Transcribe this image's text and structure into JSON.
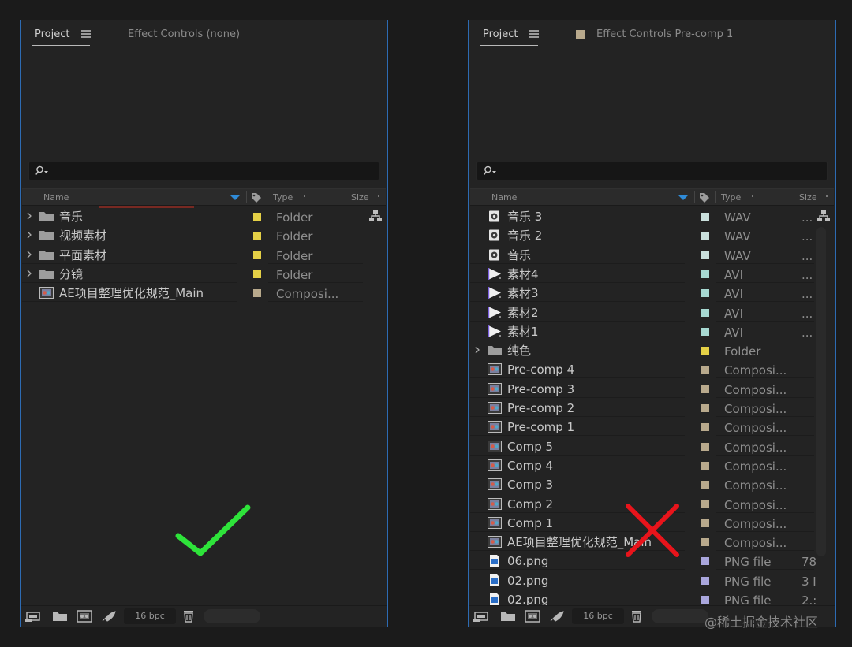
{
  "left_panel": {
    "tab_project": "Project",
    "tab_effect": "Effect Controls (none)",
    "columns": {
      "name": "Name",
      "type": "Type",
      "size": "Size"
    },
    "items": [
      {
        "name": "音乐",
        "kind": "folder",
        "expandable": true,
        "label_color": "#e4d046",
        "type": "Folder",
        "size": ""
      },
      {
        "name": "视频素材",
        "kind": "folder",
        "expandable": true,
        "label_color": "#e4d046",
        "type": "Folder",
        "size": ""
      },
      {
        "name": "平面素材",
        "kind": "folder",
        "expandable": true,
        "label_color": "#e4d046",
        "type": "Folder",
        "size": ""
      },
      {
        "name": "分镜",
        "kind": "folder",
        "expandable": true,
        "label_color": "#e4d046",
        "type": "Folder",
        "size": ""
      },
      {
        "name": "AE项目整理优化规范_Main",
        "kind": "comp",
        "expandable": false,
        "label_color": "#b8a98c",
        "type": "Composi...",
        "size": ""
      }
    ],
    "bpc": "16 bpc"
  },
  "right_panel": {
    "tab_project": "Project",
    "tab_effect": "Effect Controls Pre-comp 1",
    "tab_swatch_color": "#b8a98c",
    "columns": {
      "name": "Name",
      "type": "Type",
      "size": "Size"
    },
    "items": [
      {
        "name": "音乐 3",
        "kind": "audio",
        "expandable": false,
        "label_color": "#c9dfdc",
        "type": "WAV",
        "size": "..."
      },
      {
        "name": "音乐 2",
        "kind": "audio",
        "expandable": false,
        "label_color": "#c9dfdc",
        "type": "WAV",
        "size": "..."
      },
      {
        "name": "音乐",
        "kind": "audio",
        "expandable": false,
        "label_color": "#c9dfdc",
        "type": "WAV",
        "size": "..."
      },
      {
        "name": "素材4",
        "kind": "video",
        "expandable": false,
        "label_color": "#a7d9d2",
        "type": "AVI",
        "size": "..."
      },
      {
        "name": "素材3",
        "kind": "video",
        "expandable": false,
        "label_color": "#a7d9d2",
        "type": "AVI",
        "size": "..."
      },
      {
        "name": "素材2",
        "kind": "video",
        "expandable": false,
        "label_color": "#a7d9d2",
        "type": "AVI",
        "size": "..."
      },
      {
        "name": "素材1",
        "kind": "video",
        "expandable": false,
        "label_color": "#a7d9d2",
        "type": "AVI",
        "size": "..."
      },
      {
        "name": "纯色",
        "kind": "folder",
        "expandable": true,
        "label_color": "#e4d046",
        "type": "Folder",
        "size": ""
      },
      {
        "name": "Pre-comp 4",
        "kind": "comp",
        "expandable": false,
        "label_color": "#b8a98c",
        "type": "Composi...",
        "size": ""
      },
      {
        "name": "Pre-comp 3",
        "kind": "comp",
        "expandable": false,
        "label_color": "#b8a98c",
        "type": "Composi...",
        "size": ""
      },
      {
        "name": "Pre-comp 2",
        "kind": "comp",
        "expandable": false,
        "label_color": "#b8a98c",
        "type": "Composi...",
        "size": ""
      },
      {
        "name": "Pre-comp 1",
        "kind": "comp",
        "expandable": false,
        "label_color": "#b8a98c",
        "type": "Composi...",
        "size": ""
      },
      {
        "name": "Comp 5",
        "kind": "comp",
        "expandable": false,
        "label_color": "#b8a98c",
        "type": "Composi...",
        "size": ""
      },
      {
        "name": "Comp 4",
        "kind": "comp",
        "expandable": false,
        "label_color": "#b8a98c",
        "type": "Composi...",
        "size": ""
      },
      {
        "name": "Comp 3",
        "kind": "comp",
        "expandable": false,
        "label_color": "#b8a98c",
        "type": "Composi...",
        "size": ""
      },
      {
        "name": "Comp 2",
        "kind": "comp",
        "expandable": false,
        "label_color": "#b8a98c",
        "type": "Composi...",
        "size": ""
      },
      {
        "name": "Comp 1",
        "kind": "comp",
        "expandable": false,
        "label_color": "#b8a98c",
        "type": "Composi...",
        "size": ""
      },
      {
        "name": "AE项目整理优化规范_Main",
        "kind": "comp",
        "expandable": false,
        "label_color": "#b8a98c",
        "type": "Composi...",
        "size": ""
      },
      {
        "name": "06.png",
        "kind": "image",
        "expandable": false,
        "label_color": "#a9a6dc",
        "type": "PNG file",
        "size": "78"
      },
      {
        "name": "02.png",
        "kind": "image",
        "expandable": false,
        "label_color": "#a9a6dc",
        "type": "PNG file",
        "size": "3 I"
      },
      {
        "name": "02.png",
        "kind": "image",
        "expandable": false,
        "label_color": "#a9a6dc",
        "type": "PNG file",
        "size": "2.:"
      }
    ],
    "bpc": "16 bpc"
  },
  "watermark": "@稀土掘金技术社区",
  "colors": {
    "checkmark": "#2ee33a",
    "cross": "#e8141b",
    "panel_border": "#2d6bb3",
    "sort_arrow": "#2f8bd8"
  }
}
